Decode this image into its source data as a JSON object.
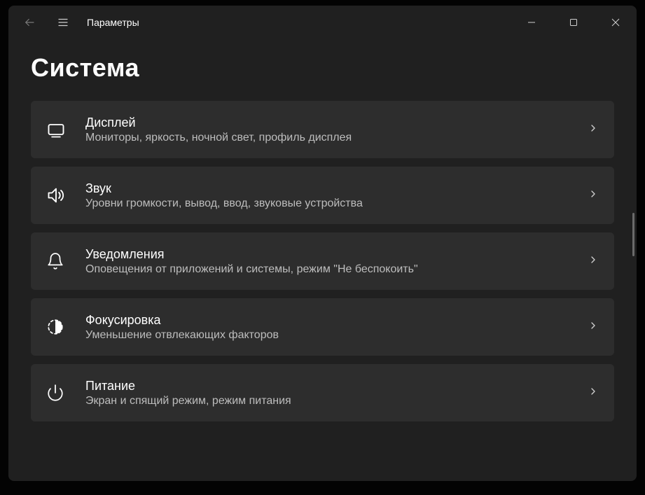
{
  "header": {
    "app_title": "Параметры"
  },
  "page": {
    "title": "Система"
  },
  "items": [
    {
      "icon": "display",
      "title": "Дисплей",
      "desc": "Мониторы, яркость, ночной свет, профиль дисплея"
    },
    {
      "icon": "sound",
      "title": "Звук",
      "desc": "Уровни громкости, вывод, ввод, звуковые устройства"
    },
    {
      "icon": "bell",
      "title": "Уведомления",
      "desc": "Оповещения от приложений и системы, режим \"Не беспокоить\""
    },
    {
      "icon": "focus",
      "title": "Фокусировка",
      "desc": "Уменьшение отвлекающих факторов"
    },
    {
      "icon": "power",
      "title": "Питание",
      "desc": "Экран и спящий режим, режим питания"
    }
  ]
}
